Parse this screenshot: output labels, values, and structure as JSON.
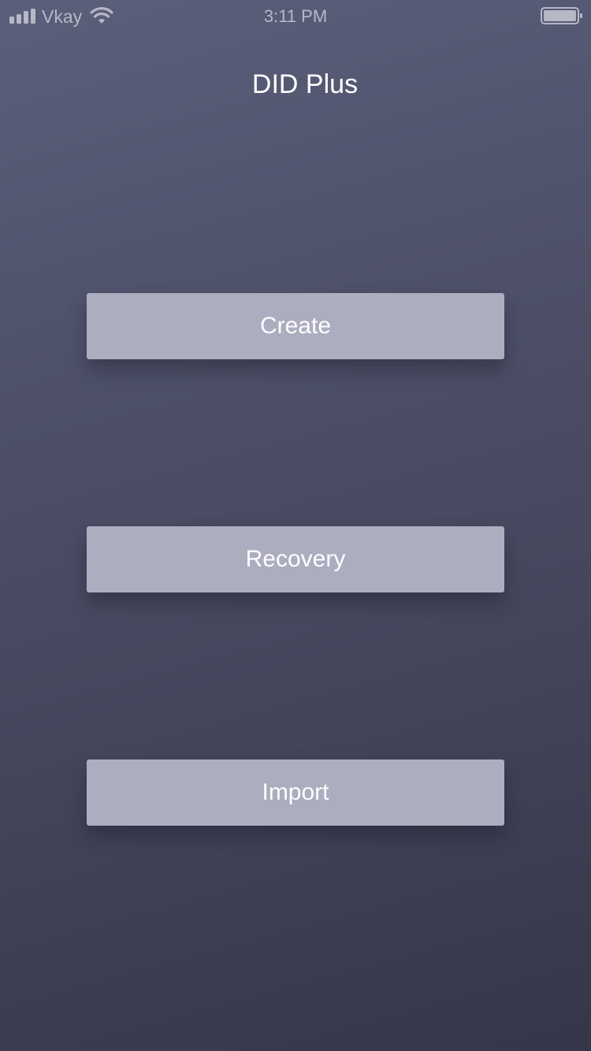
{
  "status_bar": {
    "carrier": "Vkay",
    "time": "3:11 PM",
    "icons": [
      "signal-icon",
      "wifi-icon",
      "battery-icon"
    ],
    "text_color": "#b6b8c6"
  },
  "header": {
    "title": "DID Plus"
  },
  "actions": {
    "create_label": "Create",
    "recovery_label": "Recovery",
    "import_label": "Import"
  },
  "colors": {
    "button_bg": "#adadc0",
    "background_top": "#5b5f7a",
    "background_bottom": "#353649"
  }
}
